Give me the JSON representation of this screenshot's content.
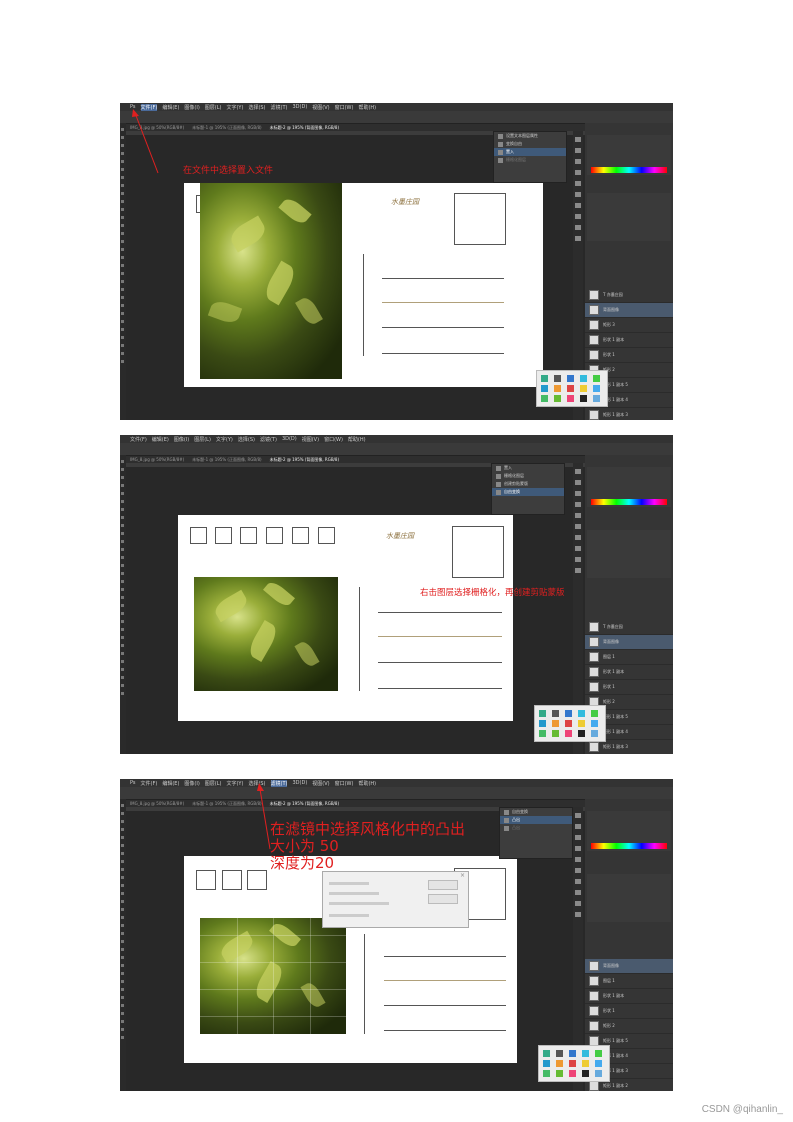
{
  "shots": [
    {
      "menu": [
        "Ps",
        "文件(F)",
        "编辑(E)",
        "图像(I)",
        "图层(L)",
        "文字(Y)",
        "选择(S)",
        "滤镜(T)",
        "3D(D)",
        "视图(V)",
        "窗口(W)",
        "帮助(H)"
      ],
      "tabs": [
        "IMG_8.jpg @ 50%(RGB/8#)",
        "未标题-1 @ 195% (正面图像, RGB/8)",
        "未标题-2 @ 195% (背面图像, RGB/8)"
      ],
      "history": [
        "设置文本图层属性",
        "变换自由",
        "置入",
        "栅格化图层"
      ],
      "title_stamp": "水墨庄园",
      "annotation": "在文件中选择置入文件",
      "layers": [
        "T 亦墨庄园",
        "背面图像",
        "矩形 3",
        "形状 1 副本",
        "形状 1",
        "矩形 2",
        "矩形 1 副本 5",
        "矩形 1 副本 4",
        "矩形 1 副本 3"
      ]
    },
    {
      "menu": [
        "文件(F)",
        "编辑(E)",
        "图像(I)",
        "图层(L)",
        "文字(Y)",
        "选择(S)",
        "滤镜(T)",
        "3D(D)",
        "视图(V)",
        "窗口(W)",
        "帮助(H)"
      ],
      "tabs": [
        "IMG_8.jpg @ 50%(RGB/8#)",
        "未标题-1 @ 195% (正面图像, RGB/8)",
        "未标题-2 @ 195% (背面图像, RGB/8)"
      ],
      "history": [
        "置入",
        "栅格化图层",
        "创建剪贴蒙版",
        "自由变换"
      ],
      "title_stamp": "水墨庄园",
      "annotation": "右击图层选择栅格化，再创建剪贴蒙版",
      "layers": [
        "T 亦墨庄园",
        "背面图像",
        "图层 1",
        "形状 1 副本",
        "形状 1",
        "矩形 2",
        "矩形 1 副本 5",
        "矩形 1 副本 4",
        "矩形 1 副本 3"
      ]
    },
    {
      "menu": [
        "Ps",
        "文件(F)",
        "编辑(E)",
        "图像(I)",
        "图层(L)",
        "文字(Y)",
        "选择(S)",
        "滤镜(T)",
        "3D(D)",
        "视图(V)",
        "窗口(W)",
        "帮助(H)"
      ],
      "tabs": [
        "IMG_8.jpg @ 50%(RGB/8#)",
        "未标题-1 @ 195% (正面图像, RGB/8)",
        "未标题-2 @ 195% (背面图像, RGB/8)"
      ],
      "history": [
        "自由变换",
        "凸出",
        "凸出"
      ],
      "title_stamp": "",
      "annotation_lines": [
        "在滤镜中选择风格化中的凸出",
        "大小为 50",
        "深度为20"
      ],
      "layers": [
        "背面图像",
        "图层 1",
        "形状 1 副本",
        "形状 1",
        "矩形 2",
        "矩形 1 副本 5",
        "矩形 1 副本 4",
        "矩形 1 副本 3",
        "矩形 1 副本 2"
      ]
    }
  ],
  "footer": "CSDN @qihanlin_"
}
